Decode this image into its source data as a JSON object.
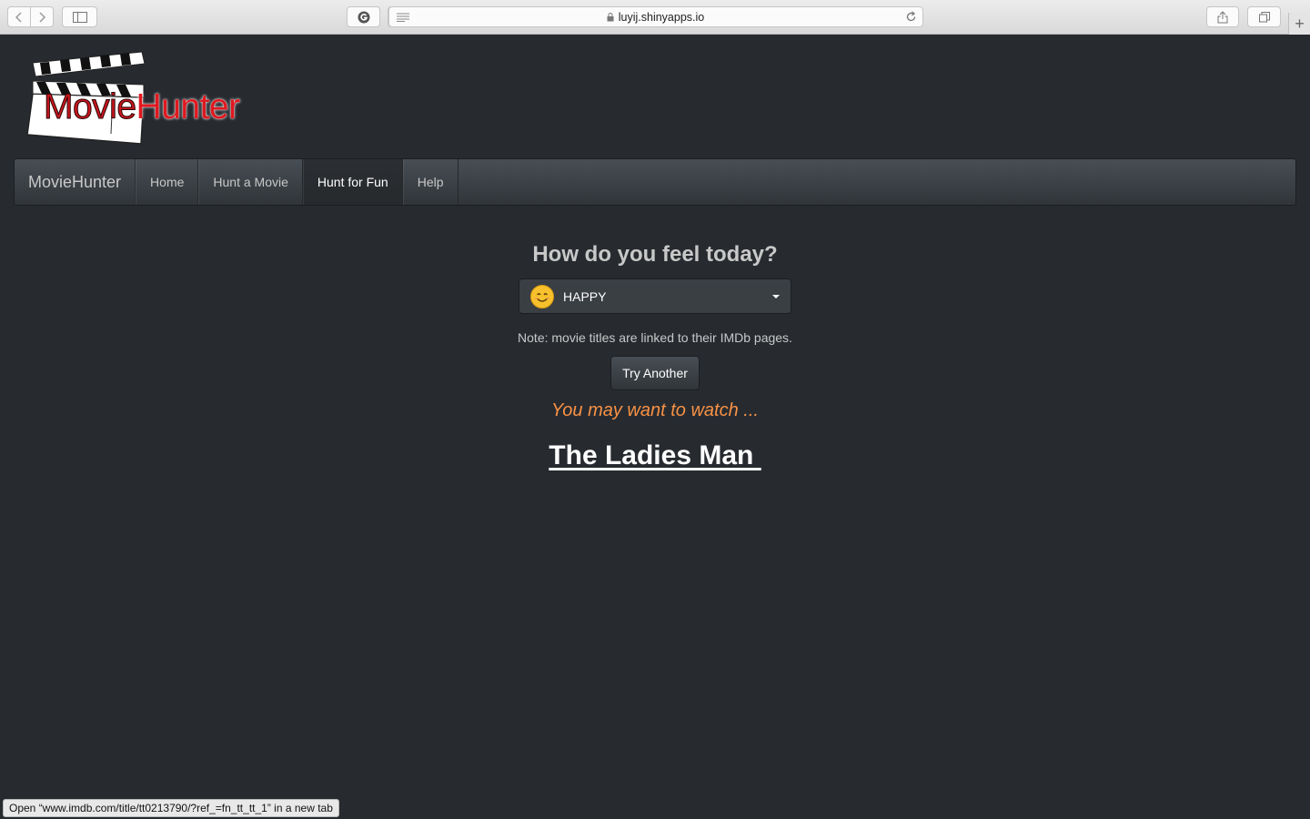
{
  "browser": {
    "url": "luyij.shinyapps.io",
    "status_text": "Open “www.imdb.com/title/tt0213790/?ref_=fn_tt_tt_1” in a new tab",
    "new_tab_label": "+"
  },
  "logo": {
    "word1": "Movie",
    "word2": "Hunter"
  },
  "navbar": {
    "brand": "MovieHunter",
    "items": [
      {
        "label": "Home",
        "active": false
      },
      {
        "label": "Hunt a Movie",
        "active": false
      },
      {
        "label": "Hunt for Fun",
        "active": true
      },
      {
        "label": "Help",
        "active": false
      }
    ]
  },
  "main": {
    "question": "How do you feel today?",
    "mood_select": {
      "value": "HAPPY",
      "icon": "smiley-face-icon"
    },
    "note": "Note: movie titles are linked to their IMDb pages.",
    "try_button": "Try Another",
    "suggestion": "You may want to watch ...",
    "movie_title": "The Ladies Man "
  },
  "colors": {
    "background": "#272b30",
    "navbar": "#3a3f44",
    "accent_orange": "#f89145",
    "logo_red": "#e0181f"
  }
}
